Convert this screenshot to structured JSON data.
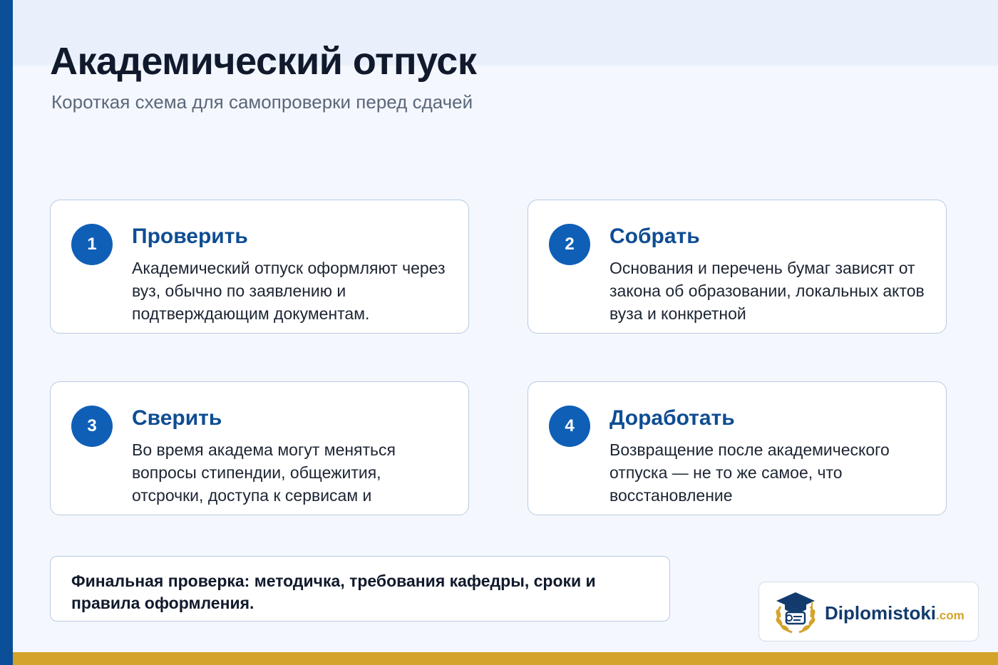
{
  "title": "Академический отпуск",
  "subtitle": "Короткая схема для самопроверки перед сдачей",
  "cards": [
    {
      "number": "1",
      "title": "Проверить",
      "text": "Академический отпуск оформляют через вуз, обычно по заявлению и подтверждающим документам."
    },
    {
      "number": "2",
      "title": "Собрать",
      "text": "Основания и перечень бумаг зависят от закона об образовании, локальных актов вуза и конкретной"
    },
    {
      "number": "3",
      "title": "Сверить",
      "text": "Во время академа могут меняться вопросы стипендии, общежития, отсрочки, доступа к сервисам и"
    },
    {
      "number": "4",
      "title": "Доработать",
      "text": "Возвращение после академического отпуска — не то же самое, что восстановление"
    }
  ],
  "final_note": "Финальная проверка: методичка, требования кафедры, сроки и правила оформления.",
  "logo": {
    "name": "Diplomistoki",
    "tld": ".com",
    "icon": "graduation-cap-laurel-icon"
  },
  "colors": {
    "accent_blue": "#0f5fb7",
    "title_blue": "#0f4d93",
    "left_bar": "#0b4f99",
    "gold": "#d4a32a",
    "background": "#f4f7fd"
  }
}
